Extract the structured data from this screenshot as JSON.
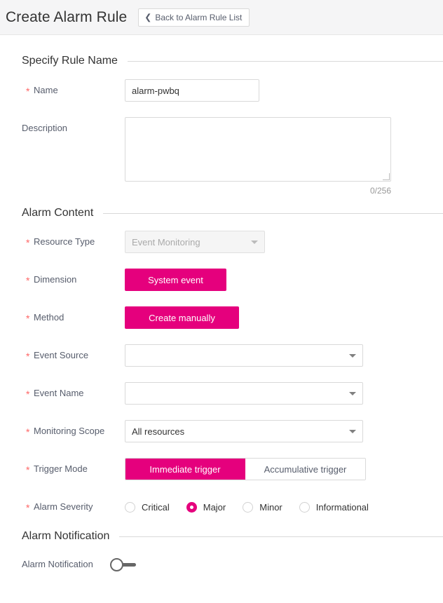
{
  "header": {
    "title": "Create Alarm Rule",
    "back_button_label": "Back to Alarm Rule List",
    "back_icon": "chevron-left-icon"
  },
  "sections": {
    "rule_name": {
      "title": "Specify Rule Name",
      "name_label": "Name",
      "name_value": "alarm-pwbq",
      "description_label": "Description",
      "description_value": "",
      "description_placeholder": "",
      "char_counter": "0/256"
    },
    "alarm_content": {
      "title": "Alarm Content",
      "resource_type_label": "Resource Type",
      "resource_type_value": "Event Monitoring",
      "dimension_label": "Dimension",
      "dimension_value": "System event",
      "method_label": "Method",
      "method_value": "Create manually",
      "event_source_label": "Event Source",
      "event_source_value": "",
      "event_name_label": "Event Name",
      "event_name_value": "",
      "monitoring_scope_label": "Monitoring Scope",
      "monitoring_scope_value": "All resources",
      "trigger_mode_label": "Trigger Mode",
      "trigger_modes": [
        {
          "label": "Immediate trigger",
          "selected": true
        },
        {
          "label": "Accumulative trigger",
          "selected": false
        }
      ],
      "alarm_severity_label": "Alarm Severity",
      "severities": [
        {
          "label": "Critical",
          "selected": false
        },
        {
          "label": "Major",
          "selected": true
        },
        {
          "label": "Minor",
          "selected": false
        },
        {
          "label": "Informational",
          "selected": false
        }
      ]
    },
    "alarm_notification": {
      "title": "Alarm Notification",
      "toggle_label": "Alarm Notification",
      "toggle_state": "off"
    }
  },
  "colors": {
    "accent_magenta": "#e5007d",
    "required_asterisk": "#ff6666",
    "header_background": "#f5f5f6",
    "border": "#d9d9d9"
  }
}
